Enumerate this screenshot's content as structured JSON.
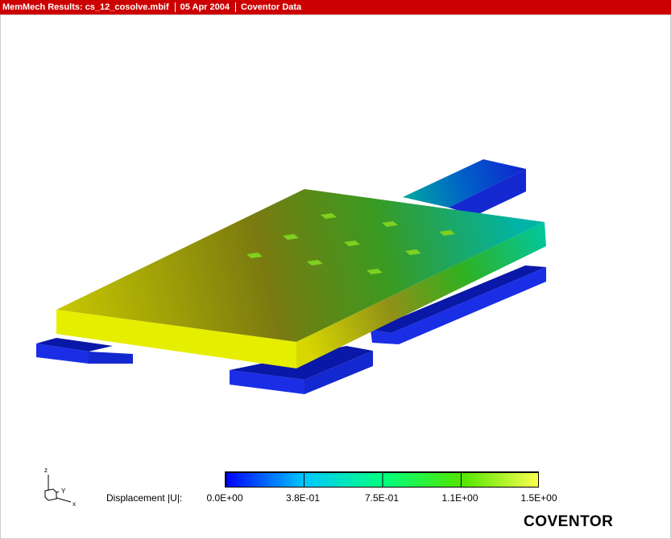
{
  "titlebar": {
    "file": "MemMech Results: cs_12_cosolve.mbif",
    "date": "05 Apr 2004",
    "source": "Coventor Data",
    "bg_color": "#cc0000"
  },
  "triad": {
    "z": "z",
    "y": "Y",
    "x": "x"
  },
  "legend": {
    "label": "Displacement |U|:",
    "ticks": [
      "0.0E+00",
      "3.8E-01",
      "7.5E-01",
      "1.1E+00",
      "1.5E+00"
    ],
    "colors": [
      "#0000ff",
      "#00c8ff",
      "#00ff64",
      "#64e600",
      "#ffff46"
    ]
  },
  "logo": "COVENTOR",
  "model": {
    "plate_high_color": "#ffff00",
    "plate_low_color": "#00b4a0",
    "anchor_color": "#1020e0"
  }
}
